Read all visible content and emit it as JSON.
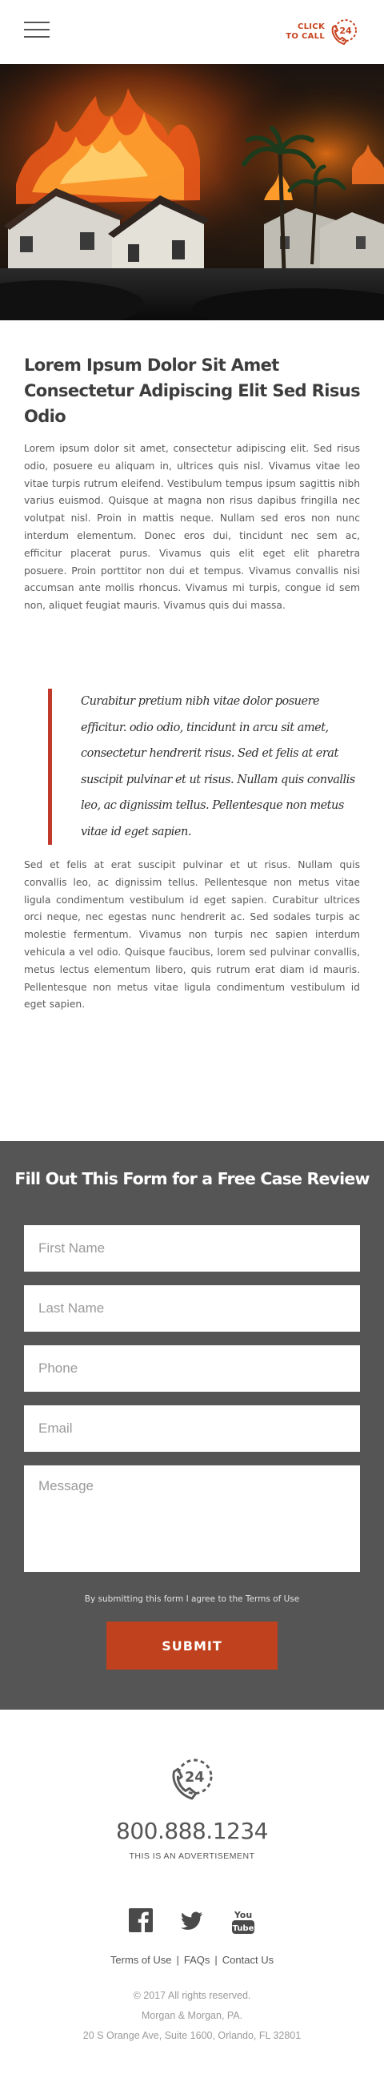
{
  "header": {
    "click_to_call_line1": "CLICK",
    "click_to_call_line2": "TO CALL",
    "badge_number": "24",
    "accent_color": "#c8431f"
  },
  "hero": {
    "image_subject": "houses burning in a wildfire at night"
  },
  "article": {
    "title": "Lorem Ipsum Dolor Sit Amet Consectetur Adipiscing Elit Sed Risus Odio",
    "paragraph1": "Lorem ipsum dolor sit amet, consectetur adipiscing elit. Sed risus odio, posuere eu aliquam in, ultrices quis nisl. Vivamus vitae leo vitae turpis rutrum eleifend. Vestibulum tempus ipsum sagittis nibh varius euismod. Quisque at magna non risus dapibus fringilla nec volutpat nisl. Proin in mattis neque. Nullam sed eros non nunc interdum elementum. Donec eros dui, tincidunt nec sem ac, efficitur placerat purus. Vivamus quis elit eget elit pharetra posuere. Proin porttitor non dui et tempus. Vivamus convallis nisi accumsan ante mollis rhoncus. Vivamus mi turpis, congue id sem non, aliquet feugiat mauris. Vivamus quis dui massa.",
    "quote": "Curabitur pretium nibh vitae dolor posuere efficitur. odio odio, tincidunt in arcu sit amet, consectetur hendrerit risus. Sed et felis at erat suscipit pulvinar et ut risus. Nullam quis convallis leo, ac dignissim tellus. Pellentesque non metus vitae id eget sapien.",
    "paragraph2": "Sed et felis at erat suscipit pulvinar et ut risus. Nullam quis convallis leo, ac dignissim tellus. Pellentesque non metus vitae ligula condimentum vestibulum id eget sapien. Curabitur ultrices orci neque, nec egestas nunc hendrerit ac. Sed sodales turpis ac molestie fermentum. Vivamus non turpis nec sapien interdum vehicula a vel odio. Quisque faucibus, lorem sed pulvinar convallis, metus lectus elementum libero, quis rutrum erat diam id mauris. Pellentesque non metus vitae ligula condimentum vestibulum id eget sapien."
  },
  "form": {
    "title": "Fill Out This Form for a Free Case Review",
    "first_name_placeholder": "First Name",
    "last_name_placeholder": "Last Name",
    "phone_placeholder": "Phone",
    "email_placeholder": "Email",
    "message_placeholder": "Message",
    "terms_text": "By submitting this form I agree to the Terms of Use",
    "submit_label": "SUBMIT",
    "background_color": "#555555",
    "button_color": "#c0411d"
  },
  "footer": {
    "badge_number": "24",
    "phone": "800.888.1234",
    "ad_notice": "THIS IS AN ADVERTISEMENT",
    "social_icons": [
      "facebook-icon",
      "twitter-icon",
      "youtube-icon"
    ],
    "youtube_label_top": "You",
    "youtube_label_bottom": "Tube",
    "links": [
      "Terms of Use",
      "FAQs",
      "Contact Us"
    ],
    "link_separator": "|",
    "copyright": "© 2017 All rights reserved.",
    "company": "Morgan & Morgan, PA.",
    "address": "20 S Orange Ave, Suite 1600, Orlando, FL 32801"
  }
}
